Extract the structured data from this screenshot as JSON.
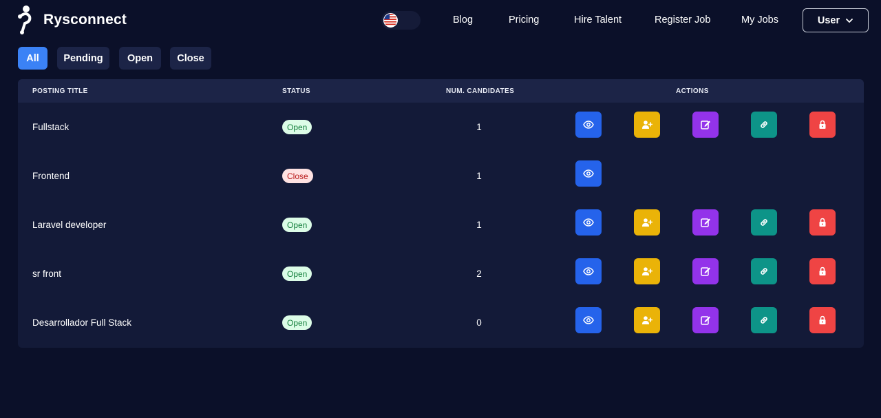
{
  "header": {
    "brand": "Rysconnect",
    "nav": [
      {
        "label": "Blog"
      },
      {
        "label": "Pricing"
      },
      {
        "label": "Hire Talent"
      },
      {
        "label": "Register Job"
      },
      {
        "label": "My Jobs"
      }
    ],
    "user_label": "User",
    "language_icon": "us-flag-icon"
  },
  "filters": [
    {
      "label": "All",
      "active": true
    },
    {
      "label": "Pending",
      "active": false
    },
    {
      "label": "Open",
      "active": false
    },
    {
      "label": "Close",
      "active": false
    }
  ],
  "table": {
    "columns": [
      "POSTING TITLE",
      "STATUS",
      "NUM. CANDIDATES",
      "ACTIONS"
    ],
    "rows": [
      {
        "title": "Fullstack",
        "status": "Open",
        "candidates": "1",
        "full_actions": true
      },
      {
        "title": "Frontend",
        "status": "Close",
        "candidates": "1",
        "full_actions": false
      },
      {
        "title": "Laravel developer",
        "status": "Open",
        "candidates": "1",
        "full_actions": true
      },
      {
        "title": "sr front",
        "status": "Open",
        "candidates": "2",
        "full_actions": true
      },
      {
        "title": "Desarrollador Full Stack",
        "status": "Open",
        "candidates": "0",
        "full_actions": true
      }
    ]
  },
  "actions": [
    {
      "icon": "eye-icon",
      "name": "view-button",
      "color": "#2563eb"
    },
    {
      "icon": "user-plus-icon",
      "name": "add-candidate-button",
      "color": "#eab308"
    },
    {
      "icon": "edit-icon",
      "name": "edit-button",
      "color": "#9333ea"
    },
    {
      "icon": "link-icon",
      "name": "share-link-button",
      "color": "#0d9488"
    },
    {
      "icon": "lock-icon",
      "name": "close-job-button",
      "color": "#ef4444"
    }
  ],
  "colors": {
    "background": "#0b1029",
    "accent": "#3b82f6",
    "open_badge_bg": "#dcfce7",
    "close_badge_bg": "#fee2e2"
  }
}
